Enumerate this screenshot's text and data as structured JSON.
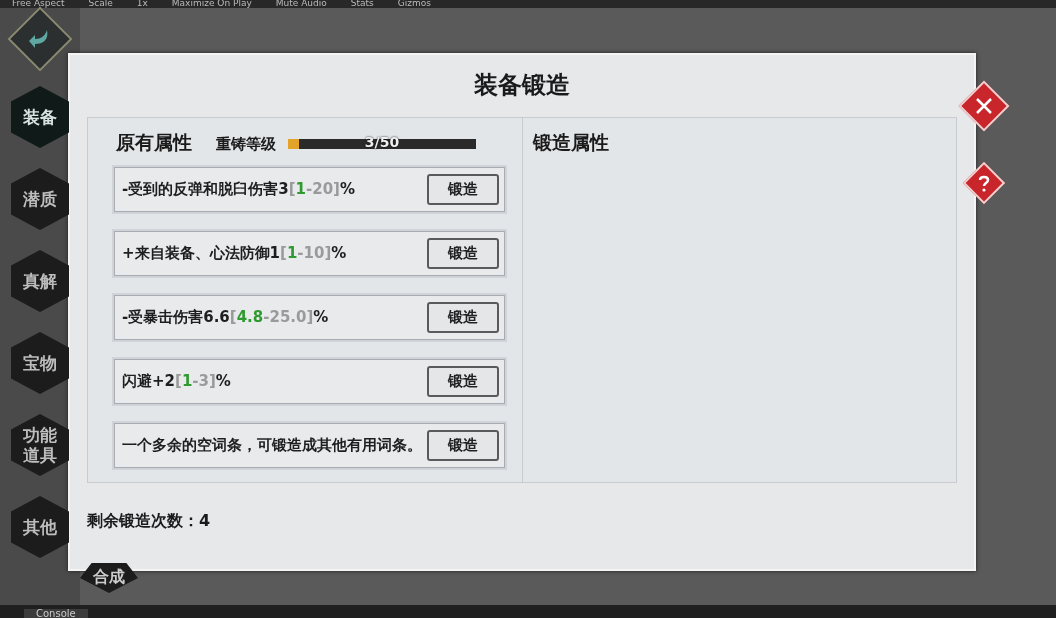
{
  "editor_toolbar": {
    "items": [
      "Free Aspect",
      "Scale",
      "1x",
      "Maximize On Play",
      "Mute Audio",
      "Stats",
      "Gizmos"
    ]
  },
  "nav": [
    {
      "label": "装备",
      "selected": true
    },
    {
      "label": "潜质",
      "selected": false
    },
    {
      "label": "真解",
      "selected": false
    },
    {
      "label": "宝物",
      "selected": false
    },
    {
      "label": "功能道具",
      "selected": false
    },
    {
      "label": "其他",
      "selected": false
    }
  ],
  "bottom_tab": "合成",
  "dialog": {
    "title": "装备锻造",
    "left_header": "原有属性",
    "reforge": {
      "label": "重铸等级",
      "reading": "3/50",
      "level": 0.06
    },
    "right_header": "锻造属性",
    "rows": [
      {
        "parts": [
          {
            "kind": "normal",
            "text": "-受到的反弹和脱臼伤害3"
          },
          {
            "kind": "dim",
            "text": "["
          },
          {
            "kind": "min",
            "text": "1"
          },
          {
            "kind": "dim",
            "text": "-20]"
          },
          {
            "kind": "normal",
            "text": "%"
          }
        ],
        "button": "锻造"
      },
      {
        "parts": [
          {
            "kind": "normal",
            "text": "+来自装备、心法防御1"
          },
          {
            "kind": "dim",
            "text": "["
          },
          {
            "kind": "min",
            "text": "1"
          },
          {
            "kind": "dim",
            "text": "-10]"
          },
          {
            "kind": "normal",
            "text": "%"
          }
        ],
        "button": "锻造"
      },
      {
        "parts": [
          {
            "kind": "normal",
            "text": "-受暴击伤害6.6"
          },
          {
            "kind": "dim",
            "text": "["
          },
          {
            "kind": "min",
            "text": "4.8"
          },
          {
            "kind": "dim",
            "text": "-25.0]"
          },
          {
            "kind": "normal",
            "text": "%"
          }
        ],
        "button": "锻造"
      },
      {
        "parts": [
          {
            "kind": "normal",
            "text": "闪避+2"
          },
          {
            "kind": "dim",
            "text": "["
          },
          {
            "kind": "min",
            "text": "1"
          },
          {
            "kind": "dim",
            "text": "-3]"
          },
          {
            "kind": "normal",
            "text": "%"
          }
        ],
        "button": "锻造"
      },
      {
        "parts": [
          {
            "kind": "normal",
            "text": "一个多余的空词条，可锻造成其他有用词条。"
          }
        ],
        "button": "锻造"
      }
    ],
    "footer": "剩余锻造次数：4"
  },
  "console_tab": "Console"
}
